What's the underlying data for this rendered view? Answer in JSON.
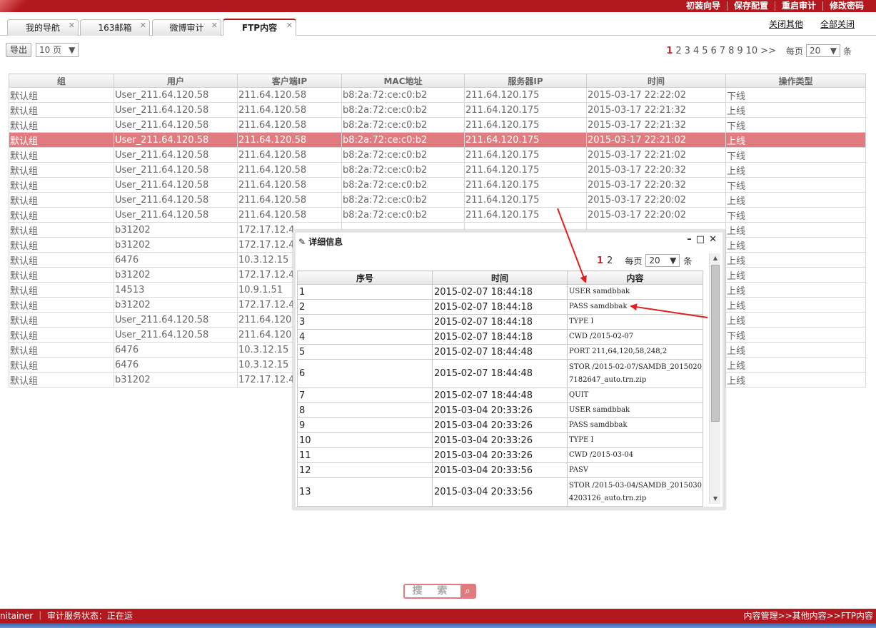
{
  "topbar": {
    "menu": [
      "初装向导",
      "保存配置",
      "重启审计",
      "修改密码"
    ]
  },
  "tabs": [
    {
      "label": "我的导航",
      "active": false
    },
    {
      "label": "163邮箱",
      "active": false
    },
    {
      "label": "微博审计",
      "active": false
    },
    {
      "label": "FTP内容",
      "active": true
    }
  ],
  "toplinks": {
    "close_others": "关闭其他",
    "close_all": "全部关闭"
  },
  "toolbar": {
    "export_label": "导出",
    "page_size": "10 页"
  },
  "pager": {
    "pages": [
      "1",
      "2",
      "3",
      "4",
      "5",
      "6",
      "7",
      "8",
      "9",
      "10"
    ],
    "current": "1",
    "next": ">>",
    "per_page_label": "每页",
    "per_page": "20",
    "unit": "条"
  },
  "table": {
    "columns": [
      "组",
      "用户",
      "客户端IP",
      "MAC地址",
      "服务器IP",
      "时间",
      "操作类型"
    ],
    "rows": [
      [
        "默认组",
        "User_211.64.120.58",
        "211.64.120.58",
        "b8:2a:72:ce:c0:b2",
        "211.64.120.175",
        "2015-03-17 22:22:02",
        "下线"
      ],
      [
        "默认组",
        "User_211.64.120.58",
        "211.64.120.58",
        "b8:2a:72:ce:c0:b2",
        "211.64.120.175",
        "2015-03-17 22:21:32",
        "上线"
      ],
      [
        "默认组",
        "User_211.64.120.58",
        "211.64.120.58",
        "b8:2a:72:ce:c0:b2",
        "211.64.120.175",
        "2015-03-17 22:21:32",
        "下线"
      ],
      [
        "默认组",
        "User_211.64.120.58",
        "211.64.120.58",
        "b8:2a:72:ce:c0:b2",
        "211.64.120.175",
        "2015-03-17 22:21:02",
        "上线"
      ],
      [
        "默认组",
        "User_211.64.120.58",
        "211.64.120.58",
        "b8:2a:72:ce:c0:b2",
        "211.64.120.175",
        "2015-03-17 22:21:02",
        "下线"
      ],
      [
        "默认组",
        "User_211.64.120.58",
        "211.64.120.58",
        "b8:2a:72:ce:c0:b2",
        "211.64.120.175",
        "2015-03-17 22:20:32",
        "上线"
      ],
      [
        "默认组",
        "User_211.64.120.58",
        "211.64.120.58",
        "b8:2a:72:ce:c0:b2",
        "211.64.120.175",
        "2015-03-17 22:20:32",
        "下线"
      ],
      [
        "默认组",
        "User_211.64.120.58",
        "211.64.120.58",
        "b8:2a:72:ce:c0:b2",
        "211.64.120.175",
        "2015-03-17 22:20:02",
        "上线"
      ],
      [
        "默认组",
        "User_211.64.120.58",
        "211.64.120.58",
        "b8:2a:72:ce:c0:b2",
        "211.64.120.175",
        "2015-03-17 22:20:02",
        "下线"
      ],
      [
        "默认组",
        "b31202",
        "172.17.12.4",
        "",
        "",
        "",
        "上线"
      ],
      [
        "默认组",
        "b31202",
        "172.17.12.4",
        "",
        "",
        "",
        "上线"
      ],
      [
        "默认组",
        "6476",
        "10.3.12.15",
        "",
        "",
        "",
        "上线"
      ],
      [
        "默认组",
        "b31202",
        "172.17.12.4",
        "",
        "",
        "",
        "上线"
      ],
      [
        "默认组",
        "14513",
        "10.9.1.51",
        "",
        "",
        "",
        "上线"
      ],
      [
        "默认组",
        "b31202",
        "172.17.12.4",
        "",
        "",
        "",
        "上线"
      ],
      [
        "默认组",
        "User_211.64.120.58",
        "211.64.120.",
        "",
        "",
        "",
        "上线"
      ],
      [
        "默认组",
        "User_211.64.120.58",
        "211.64.120.",
        "",
        "",
        "",
        "下线"
      ],
      [
        "默认组",
        "6476",
        "10.3.12.15",
        "",
        "",
        "",
        "上线"
      ],
      [
        "默认组",
        "6476",
        "10.3.12.15",
        "",
        "",
        "",
        "上线"
      ],
      [
        "默认组",
        "b31202",
        "172.17.12.4",
        "",
        "",
        "",
        "上线"
      ]
    ],
    "highlight_row": 3
  },
  "dialog": {
    "title": "详细信息",
    "pager": {
      "pages": [
        "1",
        "2"
      ],
      "current": "1",
      "per_page_label": "每页",
      "per_page": "20",
      "unit": "条"
    },
    "columns": [
      "序号",
      "时间",
      "内容"
    ],
    "rows": [
      [
        "1",
        "2015-02-07 18:44:18",
        "USER samdbbak"
      ],
      [
        "2",
        "2015-02-07 18:44:18",
        "PASS samdbbak"
      ],
      [
        "3",
        "2015-02-07 18:44:18",
        "TYPE I"
      ],
      [
        "4",
        "2015-02-07 18:44:18",
        "CWD /2015-02-07"
      ],
      [
        "5",
        "2015-02-07 18:44:48",
        "PORT 211,64,120,58,248,2"
      ],
      [
        "6",
        "2015-02-07 18:44:48",
        "STOR /2015-02-07/SAMDB_20150207182647_auto.trn.zip"
      ],
      [
        "7",
        "2015-02-07 18:44:48",
        "QUIT"
      ],
      [
        "8",
        "2015-03-04 20:33:26",
        "USER samdbbak"
      ],
      [
        "9",
        "2015-03-04 20:33:26",
        "PASS samdbbak"
      ],
      [
        "10",
        "2015-03-04 20:33:26",
        "TYPE I"
      ],
      [
        "11",
        "2015-03-04 20:33:26",
        "CWD /2015-03-04"
      ],
      [
        "12",
        "2015-03-04 20:33:56",
        "PASV"
      ],
      [
        "13",
        "2015-03-04 20:33:56",
        "STOR /2015-03-04/SAMDB_20150304203126_auto.trn.zip"
      ]
    ],
    "tall_rows": [
      5,
      12
    ]
  },
  "search": {
    "label": "搜 索"
  },
  "status": {
    "left": "nitainer ｜ 审计服务状态：正在运",
    "right": "内容管理>>其他内容>>FTP内容"
  },
  "colors": {
    "brand_red": "#b3181e",
    "highlight": "#e07c80",
    "annotation_arrow": "#e02020"
  }
}
